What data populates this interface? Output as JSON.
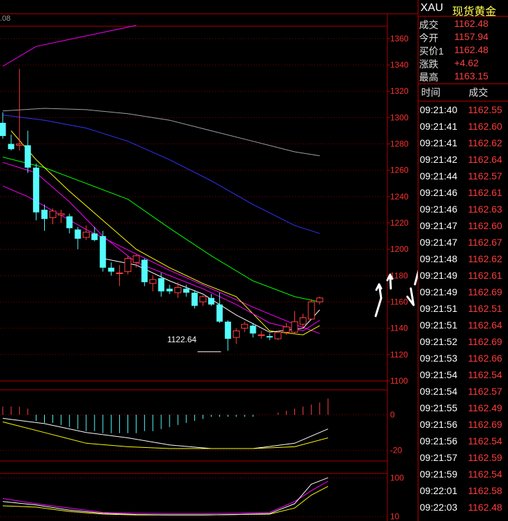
{
  "header_value": ".08",
  "quote": {
    "symbol": "XAU",
    "name": "现货黄金",
    "fields": [
      {
        "key": "成交",
        "value": "1162.48"
      },
      {
        "key": "今开",
        "value": "1157.94"
      },
      {
        "key": "买价1",
        "value": "1162.48"
      },
      {
        "key": "涨跌",
        "value": "+4.62"
      },
      {
        "key": "最高",
        "value": "1163.15"
      }
    ]
  },
  "ticks": {
    "headers": {
      "time": "时间",
      "price": "成交"
    },
    "rows": [
      {
        "time": "09:21:40",
        "price": "1162.55"
      },
      {
        "time": "09:21:41",
        "price": "1162.60"
      },
      {
        "time": "09:21:41",
        "price": "1162.62"
      },
      {
        "time": "09:21:42",
        "price": "1162.64"
      },
      {
        "time": "09:21:44",
        "price": "1162.57"
      },
      {
        "time": "09:21:46",
        "price": "1162.61"
      },
      {
        "time": "09:21:46",
        "price": "1162.63"
      },
      {
        "time": "09:21:47",
        "price": "1162.60"
      },
      {
        "time": "09:21:47",
        "price": "1162.67"
      },
      {
        "time": "09:21:48",
        "price": "1162.62"
      },
      {
        "time": "09:21:49",
        "price": "1162.61"
      },
      {
        "time": "09:21:49",
        "price": "1162.69"
      },
      {
        "time": "09:21:51",
        "price": "1162.51"
      },
      {
        "time": "09:21:51",
        "price": "1162.64"
      },
      {
        "time": "09:21:52",
        "price": "1162.69"
      },
      {
        "time": "09:21:53",
        "price": "1162.66"
      },
      {
        "time": "09:21:54",
        "price": "1162.54"
      },
      {
        "time": "09:21:54",
        "price": "1162.57"
      },
      {
        "time": "09:21:55",
        "price": "1162.49"
      },
      {
        "time": "09:21:56",
        "price": "1162.69"
      },
      {
        "time": "09:21:56",
        "price": "1162.54"
      },
      {
        "time": "09:21:57",
        "price": "1162.59"
      },
      {
        "time": "09:21:59",
        "price": "1162.54"
      },
      {
        "time": "09:22:01",
        "price": "1162.58"
      },
      {
        "time": "09:22:03",
        "price": "1162.48"
      }
    ]
  },
  "colors": {
    "up": "#ff4040",
    "down": "#54fcfc",
    "grid": "#8b0000",
    "axis": "#b00000",
    "ma5": "#ffffff",
    "ma10": "#ffff00",
    "ma20": "#ff00ff",
    "ma40": "#00ff00",
    "ma60": "#3333ff",
    "ma120": "#a0a0a0",
    "macd_dif": "#ffffff",
    "macd_dea": "#ffff00",
    "arrow": "#ffffff"
  },
  "chart_data": {
    "type": "candlestick",
    "price_axis": {
      "ticks": [
        1360,
        1340,
        1320,
        1300,
        1280,
        1260,
        1240,
        1220,
        1200,
        1180,
        1160,
        1140,
        1120,
        1100
      ],
      "ylim": [
        1100,
        1372
      ]
    },
    "annotation": {
      "label": "1122.64",
      "value": 1122.64,
      "index": 26
    },
    "candles": [
      {
        "o": 1296,
        "h": 1304,
        "l": 1284,
        "c": 1286
      },
      {
        "o": 1280,
        "h": 1287,
        "l": 1275,
        "c": 1276
      },
      {
        "o": 1279,
        "h": 1337,
        "l": 1275,
        "c": 1280
      },
      {
        "o": 1279,
        "h": 1290,
        "l": 1258,
        "c": 1262
      },
      {
        "o": 1262,
        "h": 1265,
        "l": 1222,
        "c": 1228
      },
      {
        "o": 1230,
        "h": 1234,
        "l": 1214,
        "c": 1223
      },
      {
        "o": 1224,
        "h": 1231,
        "l": 1219,
        "c": 1229
      },
      {
        "o": 1226,
        "h": 1230,
        "l": 1220,
        "c": 1227
      },
      {
        "o": 1225,
        "h": 1227,
        "l": 1212,
        "c": 1216
      },
      {
        "o": 1215,
        "h": 1217,
        "l": 1200,
        "c": 1208
      },
      {
        "o": 1209,
        "h": 1218,
        "l": 1207,
        "c": 1213
      },
      {
        "o": 1212,
        "h": 1217,
        "l": 1206,
        "c": 1207
      },
      {
        "o": 1210,
        "h": 1214,
        "l": 1183,
        "c": 1186
      },
      {
        "o": 1186,
        "h": 1190,
        "l": 1180,
        "c": 1183
      },
      {
        "o": 1182,
        "h": 1188,
        "l": 1172,
        "c": 1182
      },
      {
        "o": 1183,
        "h": 1195,
        "l": 1181,
        "c": 1193
      },
      {
        "o": 1190,
        "h": 1196,
        "l": 1186,
        "c": 1195
      },
      {
        "o": 1192,
        "h": 1193,
        "l": 1172,
        "c": 1175
      },
      {
        "o": 1174,
        "h": 1180,
        "l": 1168,
        "c": 1177
      },
      {
        "o": 1178,
        "h": 1182,
        "l": 1164,
        "c": 1168
      },
      {
        "o": 1170,
        "h": 1173,
        "l": 1166,
        "c": 1168
      },
      {
        "o": 1167,
        "h": 1175,
        "l": 1163,
        "c": 1171
      },
      {
        "o": 1170,
        "h": 1173,
        "l": 1164,
        "c": 1167
      },
      {
        "o": 1167,
        "h": 1169,
        "l": 1155,
        "c": 1157
      },
      {
        "o": 1160,
        "h": 1165,
        "l": 1157,
        "c": 1164
      },
      {
        "o": 1163,
        "h": 1166,
        "l": 1157,
        "c": 1158
      },
      {
        "o": 1158,
        "h": 1167,
        "l": 1144,
        "c": 1145
      },
      {
        "o": 1145,
        "h": 1146,
        "l": 1123,
        "c": 1132
      },
      {
        "o": 1133,
        "h": 1140,
        "l": 1128,
        "c": 1138
      },
      {
        "o": 1140,
        "h": 1145,
        "l": 1137,
        "c": 1143
      },
      {
        "o": 1142,
        "h": 1144,
        "l": 1133,
        "c": 1136
      },
      {
        "o": 1135,
        "h": 1138,
        "l": 1132,
        "c": 1135
      },
      {
        "o": 1134,
        "h": 1136,
        "l": 1131,
        "c": 1133
      },
      {
        "o": 1132,
        "h": 1138,
        "l": 1131,
        "c": 1137
      },
      {
        "o": 1137,
        "h": 1144,
        "l": 1135,
        "c": 1141
      },
      {
        "o": 1137,
        "h": 1153,
        "l": 1136,
        "c": 1145
      },
      {
        "o": 1143,
        "h": 1151,
        "l": 1141,
        "c": 1148
      },
      {
        "o": 1147,
        "h": 1162,
        "l": 1146,
        "c": 1160
      },
      {
        "o": 1160,
        "h": 1164,
        "l": 1158,
        "c": 1163
      }
    ],
    "ma": {
      "ma20": [
        [
          0,
          1248
        ],
        [
          3,
          1240
        ],
        [
          10,
          1215
        ],
        [
          20,
          1184
        ],
        [
          30,
          1156
        ],
        [
          35,
          1143
        ],
        [
          38,
          1136
        ]
      ],
      "ma20b": [
        [
          0,
          1339
        ],
        [
          4,
          1354
        ],
        [
          16,
          1370
        ]
      ],
      "ma40": [
        [
          0,
          1270
        ],
        [
          5,
          1262
        ],
        [
          10,
          1250
        ],
        [
          15,
          1238
        ],
        [
          20,
          1216
        ],
        [
          25,
          1195
        ],
        [
          30,
          1176
        ],
        [
          35,
          1164
        ],
        [
          38,
          1160
        ]
      ],
      "ma60": [
        [
          0,
          1302
        ],
        [
          5,
          1298
        ],
        [
          10,
          1292
        ],
        [
          15,
          1282
        ],
        [
          20,
          1268
        ],
        [
          25,
          1252
        ],
        [
          30,
          1234
        ],
        [
          35,
          1218
        ],
        [
          38,
          1212
        ]
      ],
      "ma120": [
        [
          0,
          1305
        ],
        [
          5,
          1307
        ],
        [
          10,
          1306
        ],
        [
          15,
          1303
        ],
        [
          20,
          1298
        ],
        [
          25,
          1290
        ],
        [
          30,
          1282
        ],
        [
          35,
          1274
        ],
        [
          38,
          1271
        ]
      ],
      "ma10": [
        [
          1,
          1290
        ],
        [
          4,
          1268
        ],
        [
          8,
          1244
        ],
        [
          12,
          1222
        ],
        [
          16,
          1200
        ],
        [
          20,
          1186
        ],
        [
          24,
          1174
        ],
        [
          28,
          1164
        ],
        [
          32,
          1138
        ],
        [
          36,
          1135
        ],
        [
          38,
          1142
        ]
      ],
      "ma20c": [
        [
          0,
          1266
        ],
        [
          4,
          1258
        ],
        [
          8,
          1236
        ],
        [
          12,
          1210
        ],
        [
          16,
          1190
        ],
        [
          20,
          1180
        ],
        [
          24,
          1170
        ],
        [
          28,
          1158
        ],
        [
          32,
          1144
        ],
        [
          36,
          1138
        ],
        [
          38,
          1146
        ]
      ],
      "ma5": [
        [
          12,
          1193
        ],
        [
          16,
          1188
        ],
        [
          20,
          1176
        ],
        [
          24,
          1166
        ],
        [
          28,
          1150
        ],
        [
          32,
          1137
        ],
        [
          36,
          1140
        ],
        [
          38,
          1154
        ]
      ]
    },
    "macd": {
      "ylim": [
        -26,
        14
      ],
      "ticks": [
        0,
        -20
      ],
      "hist": [
        4,
        4,
        4,
        3,
        -3,
        -4,
        -4,
        -5,
        -6,
        -7,
        -8,
        -8,
        -9,
        -9,
        -9,
        -9,
        -9,
        -8,
        -8,
        -7,
        -6,
        -5,
        -4,
        -3,
        -2,
        -1,
        -1,
        -1,
        -1,
        -1,
        -1,
        0,
        0,
        1,
        2,
        3,
        4,
        5,
        6,
        8
      ],
      "dif": [
        [
          0,
          -2
        ],
        [
          5,
          -5
        ],
        [
          10,
          -10
        ],
        [
          15,
          -13
        ],
        [
          20,
          -17
        ],
        [
          25,
          -19
        ],
        [
          30,
          -19
        ],
        [
          35,
          -16
        ],
        [
          39,
          -8
        ]
      ],
      "dea": [
        [
          0,
          -4
        ],
        [
          5,
          -10
        ],
        [
          10,
          -16
        ],
        [
          15,
          -18
        ],
        [
          20,
          -19
        ],
        [
          25,
          -19
        ],
        [
          30,
          -19
        ],
        [
          35,
          -18
        ],
        [
          39,
          -13
        ]
      ]
    },
    "osc": {
      "ylim": [
        0,
        110
      ],
      "ticks": [
        100,
        10
      ],
      "k": [
        [
          0,
          45
        ],
        [
          4,
          37
        ],
        [
          8,
          25
        ],
        [
          12,
          18
        ],
        [
          16,
          15
        ],
        [
          20,
          14
        ],
        [
          24,
          14
        ],
        [
          28,
          15
        ],
        [
          32,
          17
        ],
        [
          35,
          40
        ],
        [
          37,
          85
        ],
        [
          39,
          100
        ]
      ],
      "d": [
        [
          0,
          35
        ],
        [
          4,
          32
        ],
        [
          8,
          22
        ],
        [
          12,
          16
        ],
        [
          16,
          14
        ],
        [
          20,
          14
        ],
        [
          24,
          14
        ],
        [
          28,
          15
        ],
        [
          32,
          16
        ],
        [
          35,
          30
        ],
        [
          37,
          60
        ],
        [
          39,
          80
        ]
      ],
      "j": [
        [
          0,
          52
        ],
        [
          4,
          40
        ],
        [
          8,
          30
        ],
        [
          12,
          20
        ],
        [
          16,
          18
        ],
        [
          20,
          17
        ],
        [
          24,
          17
        ],
        [
          28,
          18
        ],
        [
          32,
          20
        ],
        [
          35,
          45
        ],
        [
          37,
          70
        ],
        [
          39,
          92
        ]
      ]
    }
  }
}
